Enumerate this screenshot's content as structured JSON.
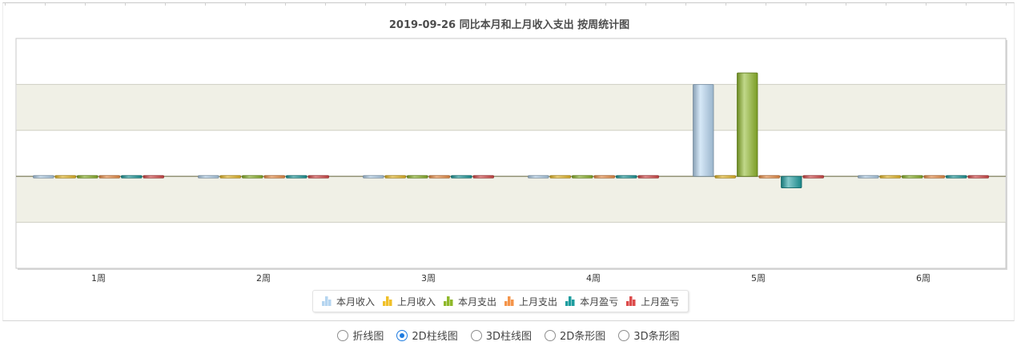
{
  "chart_data": {
    "type": "bar",
    "title": "2019-09-26 同比本月和上月收入支出 按周统计图",
    "categories": [
      "1周",
      "2周",
      "3周",
      "4周",
      "5周",
      "6周"
    ],
    "series": [
      {
        "name": "本月收入",
        "color": "#b5d5f0",
        "values": [
          0,
          0,
          0,
          0,
          1600,
          0
        ]
      },
      {
        "name": "上月收入",
        "color": "#f0c02a",
        "values": [
          0,
          0,
          0,
          0,
          0,
          0
        ]
      },
      {
        "name": "本月支出",
        "color": "#8fb82a",
        "values": [
          0,
          0,
          0,
          0,
          1800,
          0
        ]
      },
      {
        "name": "上月支出",
        "color": "#f4944a",
        "values": [
          0,
          0,
          0,
          0,
          0,
          0
        ]
      },
      {
        "name": "本月盈亏",
        "color": "#1d9d9f",
        "values": [
          0,
          0,
          0,
          0,
          -200,
          0
        ]
      },
      {
        "name": "上月盈亏",
        "color": "#dc4b4b",
        "values": [
          0,
          0,
          0,
          0,
          0,
          0
        ]
      }
    ],
    "ylim": [
      -1600,
      2400
    ],
    "grid": true,
    "legend": "bottom-center"
  },
  "chart_types": {
    "options": [
      "折线图",
      "2D柱线图",
      "3D柱线图",
      "2D条形图",
      "3D条形图"
    ],
    "selected": "2D柱线图"
  }
}
